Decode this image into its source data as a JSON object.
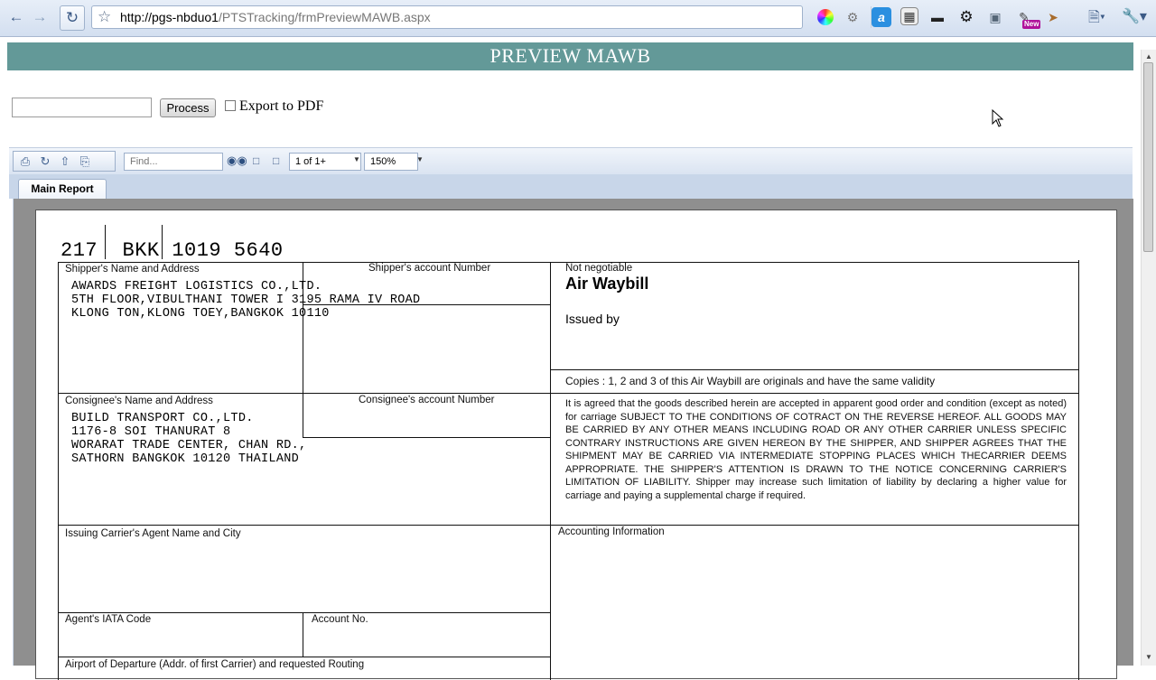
{
  "browser": {
    "url_host": "http://pgs-nbduo1",
    "url_path": "/PTSTracking/frmPreviewMAWB.aspx",
    "ext_badge": "New"
  },
  "page": {
    "title": "PREVIEW MAWB",
    "mawb_input_value": "",
    "process_label": "Process",
    "export_label": "Export to PDF",
    "export_checked": false
  },
  "viewer": {
    "find_placeholder": "Find...",
    "page_indicator": "1 of 1+",
    "zoom": "150%",
    "tab_main": "Main Report"
  },
  "awb": {
    "number": "217  BKK 1019 5640",
    "labels": {
      "shipper_name": "Shipper's Name and Address",
      "shipper_account": "Shipper's account Number",
      "not_negotiable": "Not negotiable",
      "air_waybill": "Air Waybill",
      "issued_by": "Issued by",
      "copies": "Copies : 1, 2 and 3 of this Air Waybill are originals and have the same validity",
      "consignee_name": "Consignee's Name and Address",
      "consignee_account": "Consignee's account Number",
      "issuing_agent": "Issuing Carrier's Agent Name and City",
      "accounting": "Accounting Information",
      "iata_code": "Agent's IATA Code",
      "account_no": "Account No.",
      "airport_departure": "Airport of Departure (Addr. of first Carrier) and requested Routing"
    },
    "shipper_lines": [
      "AWARDS FREIGHT LOGISTICS CO.,LTD.",
      "5TH FLOOR,VIBULTHANI TOWER I 3195 RAMA IV ROAD",
      "KLONG TON,KLONG TOEY,BANGKOK 10110"
    ],
    "consignee_lines": [
      "BUILD TRANSPORT CO.,LTD.",
      "1176-8 SOI THANURAT 8",
      "WORARAT TRADE CENTER, CHAN RD.,",
      "SATHORN BANGKOK 10120 THAILAND"
    ],
    "terms_text": "It is agreed that the goods described herein are accepted in apparent good order and condition (except as noted) for carriage SUBJECT TO THE CONDITIONS OF COTRACT ON THE REVERSE HEREOF. ALL GOODS MAY BE CARRIED BY ANY OTHER MEANS INCLUDING ROAD OR ANY OTHER CARRIER UNLESS SPECIFIC CONTRARY INSTRUCTIONS ARE GIVEN HEREON BY THE SHIPPER, AND SHIPPER AGREES THAT THE SHIPMENT MAY BE CARRIED VIA INTERMEDIATE STOPPING PLACES WHICH THECARRIER DEEMS APPROPRIATE. THE SHIPPER'S ATTENTION IS DRAWN TO THE NOTICE CONCERNING CARRIER'S LIMITATION OF LIABILITY. Shipper may increase such limitation of liability by declaring a higher value for carriage and paying a supplemental charge if required."
  }
}
